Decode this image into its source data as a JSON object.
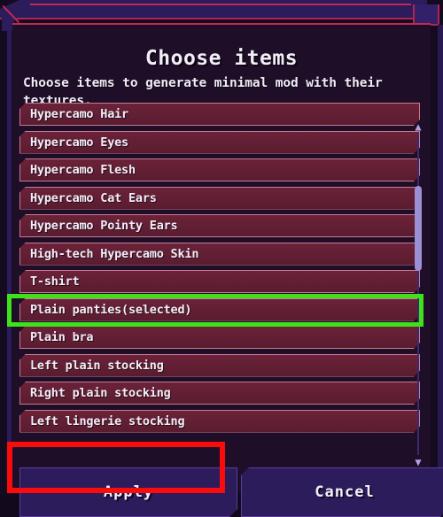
{
  "dialog": {
    "title": "Choose items",
    "description": "Choose items to generate minimal mod with their textures."
  },
  "list": {
    "items": [
      {
        "label": "Hypercamo Hair",
        "selected": false
      },
      {
        "label": "Hypercamo Eyes",
        "selected": false
      },
      {
        "label": "Hypercamo Flesh",
        "selected": false
      },
      {
        "label": "Hypercamo Cat Ears",
        "selected": false
      },
      {
        "label": "Hypercamo Pointy Ears",
        "selected": false
      },
      {
        "label": "High-tech Hypercamo Skin",
        "selected": false
      },
      {
        "label": "T-shirt",
        "selected": false
      },
      {
        "label": "Plain panties(selected)",
        "selected": true
      },
      {
        "label": "Plain bra",
        "selected": false
      },
      {
        "label": "Left plain stocking",
        "selected": false
      },
      {
        "label": "Right plain stocking",
        "selected": false
      },
      {
        "label": "Left lingerie stocking",
        "selected": false
      }
    ]
  },
  "scrollbar": {
    "up_arrow": "▲",
    "down_arrow": "▼"
  },
  "buttons": {
    "apply_label": "Apply",
    "cancel_label": "Cancel"
  },
  "annotations": {
    "selected_item_highlight_color": "#3fe21a",
    "apply_button_highlight_color": "#fb0b0b"
  },
  "colors": {
    "dialog_background": "#1e0e28",
    "frame_band": "#2d1c5c",
    "frame_line": "#c02a55",
    "item_background": "#5a1c30",
    "item_border": "#c97a92",
    "button_background": "#2d1c5c",
    "text": "#f3eef8",
    "scrollbar_thumb": "#9b8fd6"
  }
}
